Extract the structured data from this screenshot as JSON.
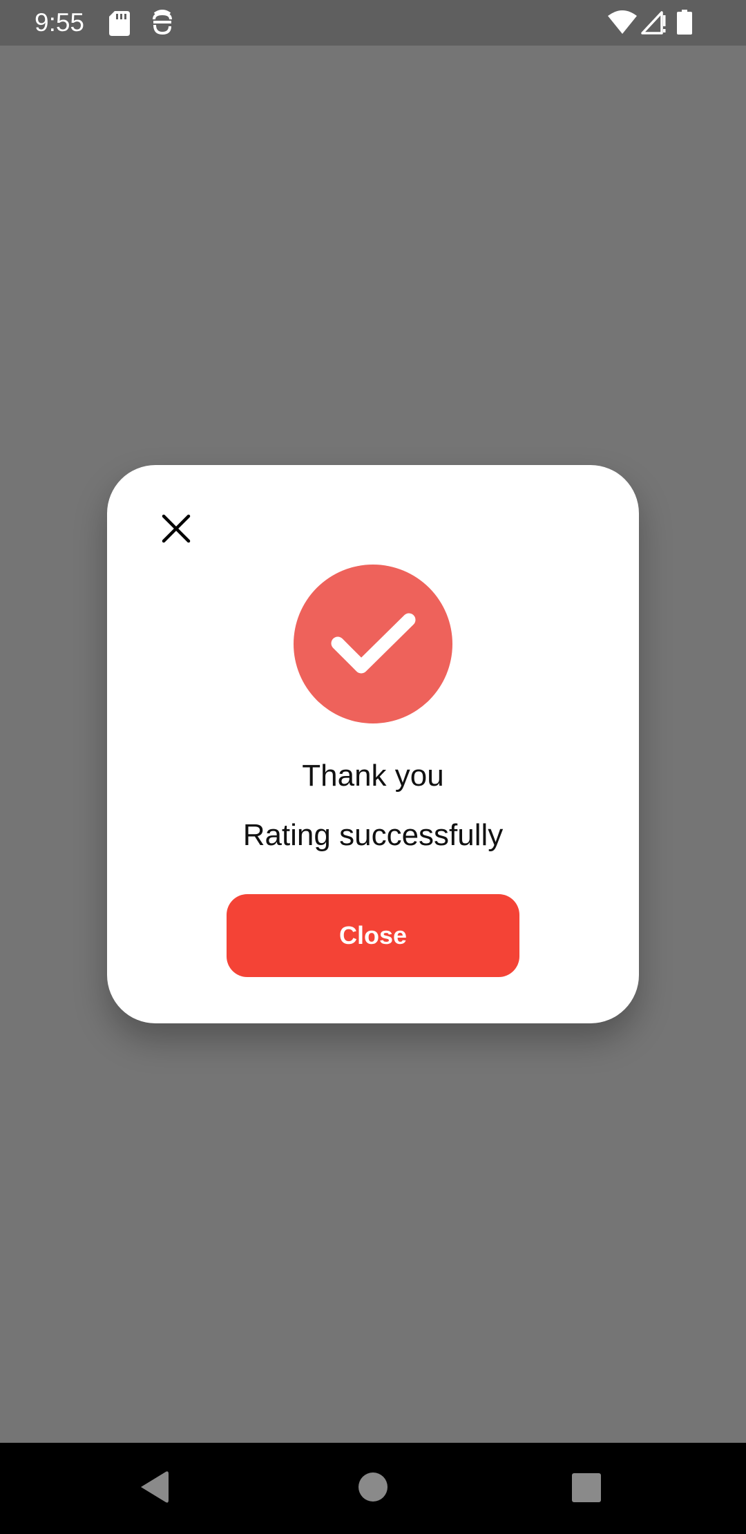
{
  "status_bar": {
    "time": "9:55",
    "icons": [
      "sd-card-icon",
      "face-icon",
      "wifi-icon",
      "signal-icon",
      "battery-icon"
    ]
  },
  "dialog": {
    "title": "Thank you",
    "message": "Rating successfully",
    "close_button_label": "Close",
    "icons": [
      "close-icon",
      "checkmark-icon"
    ]
  },
  "navigation_bar": {
    "icons": [
      "back-icon",
      "home-icon",
      "recents-icon"
    ]
  },
  "colors": {
    "scrim": "#757575",
    "status_bar": "#5f5f5f",
    "success_badge": "#ee625b",
    "primary_button": "#f44336",
    "nav_bar": "#000000"
  }
}
